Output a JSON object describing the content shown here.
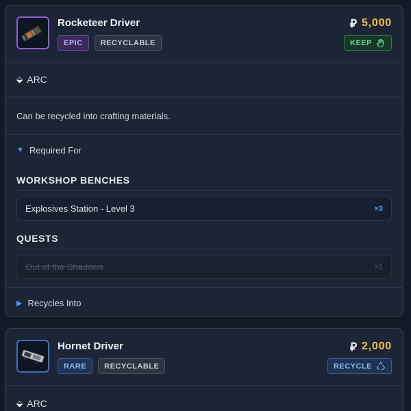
{
  "items": [
    {
      "name": "Rocketeer Driver",
      "rarity": "EPIC",
      "tag": "RECYCLABLE",
      "price": "5,000",
      "action": "KEEP",
      "source": "ARC",
      "description": "Can be recycled into crafting materials.",
      "required_for_label": "Required For",
      "sections": [
        {
          "title": "WORKSHOP BENCHES",
          "entries": [
            {
              "name": "Explosives Station - Level 3",
              "qty": "×3"
            }
          ]
        },
        {
          "title": "QUESTS",
          "entries": [
            {
              "name": "Out of the Shadows",
              "qty": "×1"
            }
          ]
        }
      ],
      "recycles_label": "Recycles Into",
      "rarity_color": "#8e5fd0",
      "icon": "rocketeer-driver-item-icon"
    },
    {
      "name": "Hornet Driver",
      "rarity": "RARE",
      "tag": "RECYCLABLE",
      "price": "2,000",
      "action": "RECYCLE",
      "source": "ARC",
      "rarity_color": "#3d6fb8",
      "icon": "hornet-driver-item-icon"
    }
  ],
  "icons": {
    "coin": "⃁",
    "arc": "⬙",
    "expanded": "▼",
    "collapsed": "▶"
  },
  "colors": {
    "price": "#f0c040",
    "keep": "#6fd79a",
    "accent": "#4f8ff0"
  }
}
